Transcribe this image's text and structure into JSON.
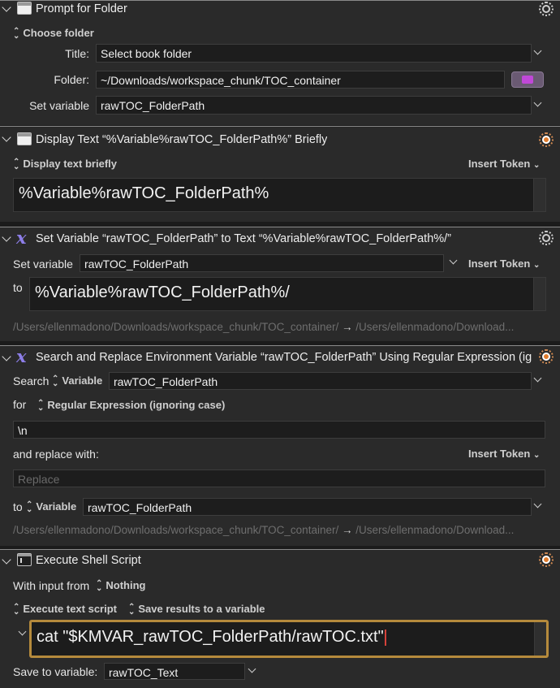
{
  "action1": {
    "title": "Prompt for Folder",
    "mode": "Choose folder",
    "title_label": "Title:",
    "title_value": "Select book folder",
    "folder_label": "Folder:",
    "folder_value": "~/Downloads/workspace_chunk/TOC_container",
    "setvar_label": "Set variable",
    "setvar_value": "rawTOC_FolderPath"
  },
  "action2": {
    "title": "Display Text “%Variable%rawTOC_FolderPath%” Briefly",
    "mode": "Display text briefly",
    "insert_token": "Insert Token",
    "text": "%Variable%rawTOC_FolderPath%"
  },
  "action3": {
    "title": "Set Variable “rawTOC_FolderPath” to Text “%Variable%rawTOC_FolderPath%/”",
    "setvar_label": "Set variable",
    "setvar_value": "rawTOC_FolderPath",
    "insert_token": "Insert Token",
    "to_label": "to",
    "text": "%Variable%rawTOC_FolderPath%/",
    "preview_from": "/Users/ellenmadono/Downloads/workspace_chunk/TOC_container/",
    "preview_arrow": "→",
    "preview_to": "/Users/ellenmadono/Download..."
  },
  "action4": {
    "title": "Search and Replace Environment Variable “rawTOC_FolderPath” Using Regular Expression (ig...",
    "search_label": "Search",
    "search_source": "Variable",
    "search_var": "rawTOC_FolderPath",
    "for_label": "for",
    "match_mode": "Regular Expression (ignoring case)",
    "pattern": "\\n",
    "replace_label": "and replace with:",
    "insert_token": "Insert Token",
    "replace_placeholder": "Replace",
    "to_label": "to",
    "to_source": "Variable",
    "to_var": "rawTOC_FolderPath",
    "preview_from": "/Users/ellenmadono/Downloads/workspace_chunk/TOC_container/",
    "preview_arrow": "→",
    "preview_to": "/Users/ellenmadono/Download..."
  },
  "action5": {
    "title": "Execute Shell Script",
    "input_label": "With input from",
    "input_value": "Nothing",
    "exec_mode": "Execute text script",
    "result_mode": "Save results to a variable",
    "script": "cat \"$KMVAR_rawTOC_FolderPath/rawTOC.txt\"",
    "save_label": "Save to variable:",
    "save_value": "rawTOC_Text"
  },
  "colors": {
    "background": "#2a2a2a",
    "focus_ring": "#b58a3c",
    "macro_icon": "#8d7ee8",
    "gear_active": "#e07b2c"
  }
}
